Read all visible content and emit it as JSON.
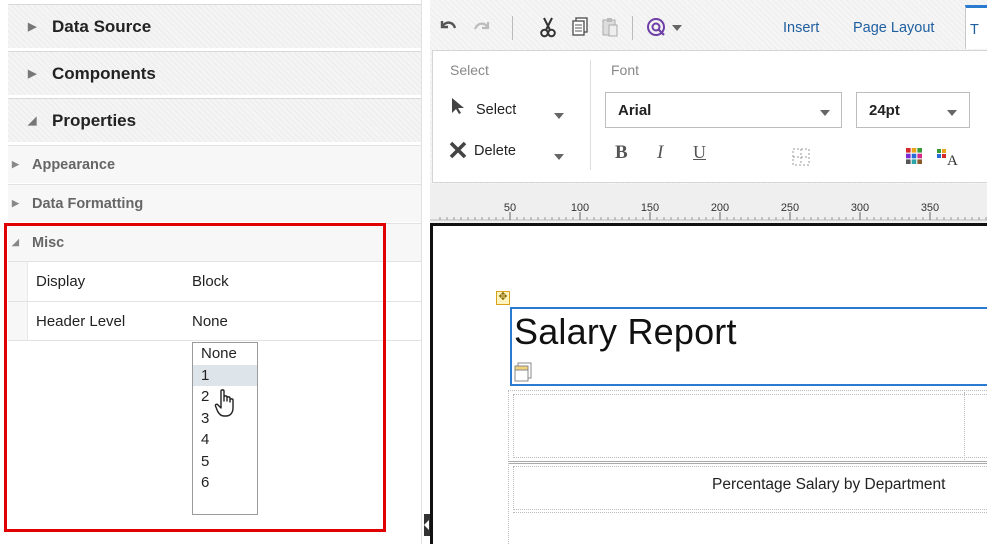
{
  "left_panel": {
    "sections": [
      {
        "label": "Data Source",
        "expanded": false
      },
      {
        "label": "Components",
        "expanded": false
      },
      {
        "label": "Properties",
        "expanded": true
      }
    ],
    "property_groups": [
      {
        "label": "Appearance",
        "expanded": false
      },
      {
        "label": "Data Formatting",
        "expanded": false
      },
      {
        "label": "Misc",
        "expanded": true
      }
    ],
    "properties": [
      {
        "name": "Display",
        "value": "Block"
      },
      {
        "name": "Header Level",
        "value": "None"
      }
    ],
    "header_level_dropdown": {
      "options": [
        "None",
        "1",
        "2",
        "3",
        "4",
        "5",
        "6"
      ],
      "highlighted": "1"
    },
    "annotation_color": "#e00000"
  },
  "toolbar": {
    "icons": [
      "undo-icon",
      "redo-icon",
      "cut-icon",
      "copy-icon",
      "paste-icon",
      "format-painter-icon"
    ],
    "tabs": [
      "Insert",
      "Page Layout",
      "T"
    ],
    "select_group": {
      "label": "Select",
      "select_label": "Select",
      "delete_label": "Delete"
    },
    "font_group": {
      "label": "Font",
      "font_family": "Arial",
      "font_size": "24pt",
      "bold": "B",
      "italic": "I",
      "underline": "U"
    }
  },
  "ruler": {
    "ticks": [
      "50",
      "100",
      "150",
      "200",
      "250",
      "300",
      "350"
    ]
  },
  "report": {
    "title": "Salary Report",
    "chart_title": "Percentage Salary by Department"
  },
  "accent_color": "#2a7ad0"
}
